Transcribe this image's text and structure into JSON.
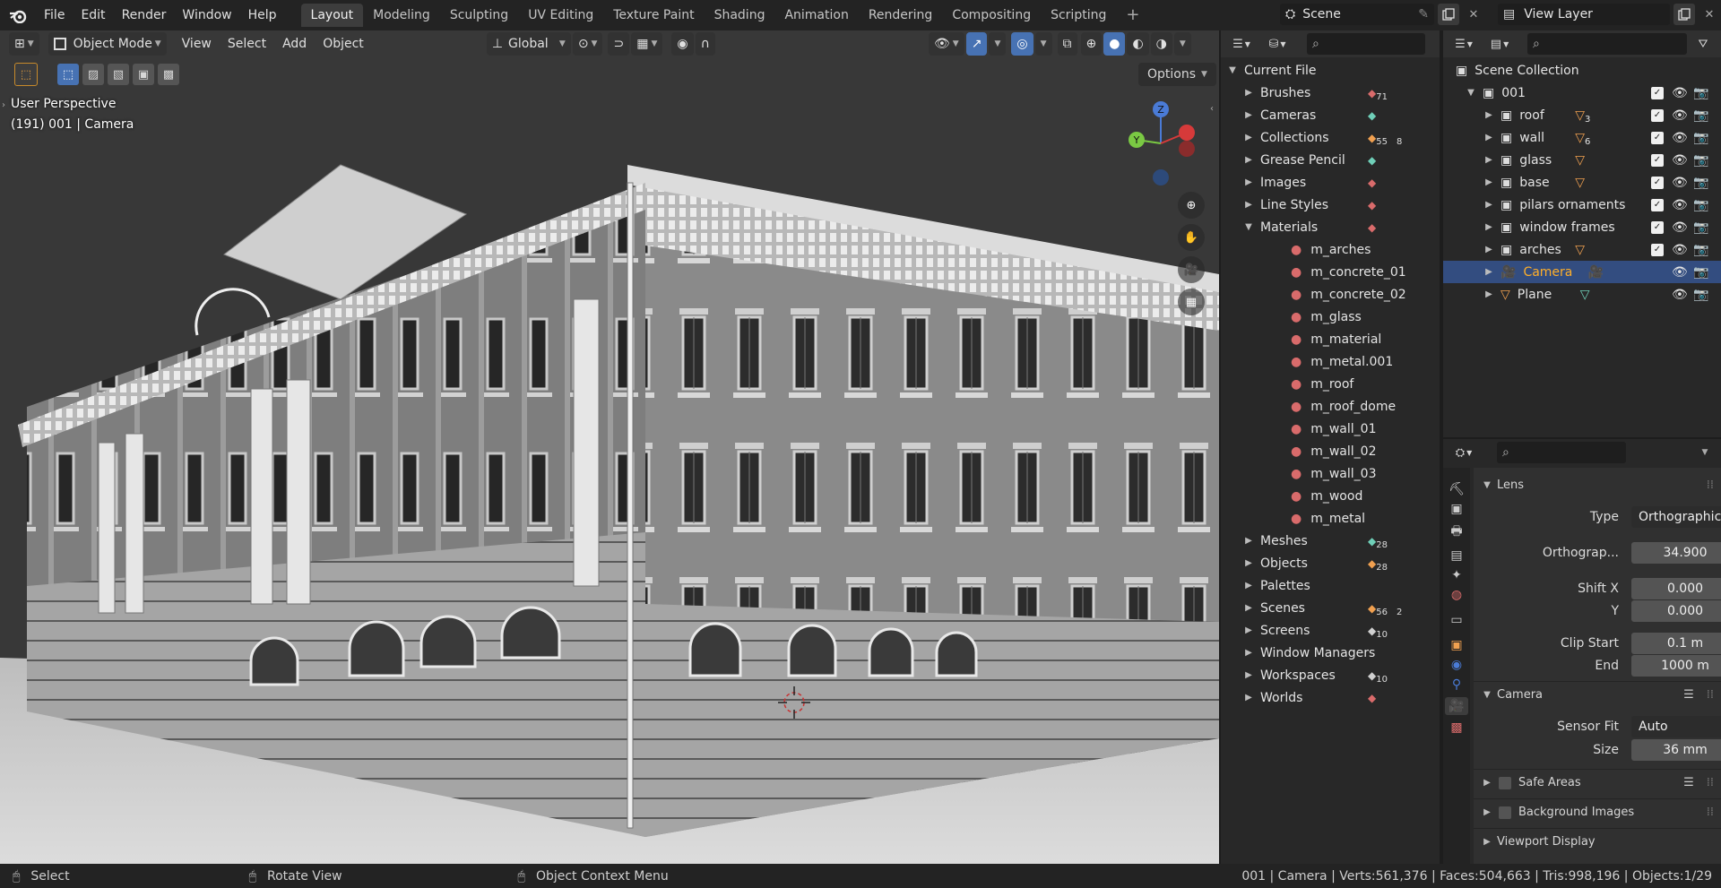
{
  "topbar": {
    "menus": [
      "File",
      "Edit",
      "Render",
      "Window",
      "Help"
    ],
    "workspaces": [
      "Layout",
      "Modeling",
      "Sculpting",
      "UV Editing",
      "Texture Paint",
      "Shading",
      "Animation",
      "Rendering",
      "Compositing",
      "Scripting"
    ],
    "active_workspace": "Layout",
    "add_workspace": "+",
    "scene": "Scene",
    "view_layer": "View Layer"
  },
  "viewport": {
    "mode": "Object Mode",
    "menus": [
      "View",
      "Select",
      "Add",
      "Object"
    ],
    "orientation": "Global",
    "options": "Options",
    "overlay_title": "User Perspective",
    "overlay_sub": "(191) 001 | Camera",
    "gizmo": {
      "z": "Z",
      "y": "Y"
    }
  },
  "file_browser": {
    "root": "Current File",
    "items": [
      {
        "label": "Brushes",
        "count": "71",
        "color": "#d96b6b"
      },
      {
        "label": "Cameras",
        "count": "",
        "color": "#6fcfb8"
      },
      {
        "label": "Collections",
        "count": "55",
        "count2": "8",
        "color": "#f0a050"
      },
      {
        "label": "Grease Pencil",
        "count": "",
        "color": "#6fcfb8"
      },
      {
        "label": "Images",
        "count": "",
        "color": "#d96b6b"
      },
      {
        "label": "Line Styles",
        "count": "",
        "color": "#d96b6b"
      },
      {
        "label": "Materials",
        "count": "",
        "color": "#d96b6b",
        "expanded": true
      },
      {
        "label": "Meshes",
        "count": "28",
        "color": "#6fcfb8"
      },
      {
        "label": "Objects",
        "count": "28",
        "color": "#f0a050"
      },
      {
        "label": "Palettes",
        "count": "",
        "color": ""
      },
      {
        "label": "Scenes",
        "count": "56",
        "count2": "2",
        "color": "#f0a050"
      },
      {
        "label": "Screens",
        "count": "10",
        "color": "#d0d0d0"
      },
      {
        "label": "Window Managers",
        "count": "",
        "color": ""
      },
      {
        "label": "Workspaces",
        "count": "10",
        "color": "#d0d0d0"
      },
      {
        "label": "Worlds",
        "count": "",
        "color": "#d96b6b"
      }
    ],
    "materials": [
      "m_arches",
      "m_concrete_01",
      "m_concrete_02",
      "m_glass",
      "m_material",
      "m_metal.001",
      "m_roof",
      "m_roof_dome",
      "m_wall_01",
      "m_wall_02",
      "m_wall_03",
      "m_wood",
      "m_metal"
    ]
  },
  "outliner": {
    "root": "Scene Collection",
    "collection": "001",
    "items": [
      {
        "label": "roof",
        "count": "3",
        "selected": false,
        "type": "collection"
      },
      {
        "label": "wall",
        "count": "6",
        "selected": false,
        "type": "collection"
      },
      {
        "label": "glass",
        "count": "",
        "selected": false,
        "type": "collection"
      },
      {
        "label": "base",
        "count": "",
        "selected": false,
        "type": "collection"
      },
      {
        "label": "pilars ornaments",
        "count": "",
        "selected": false,
        "type": "collection"
      },
      {
        "label": "window frames",
        "count": "",
        "selected": false,
        "type": "collection"
      },
      {
        "label": "arches",
        "count": "",
        "selected": false,
        "type": "collection"
      },
      {
        "label": "Camera",
        "count": "",
        "selected": true,
        "type": "camera"
      },
      {
        "label": "Plane",
        "count": "",
        "selected": false,
        "type": "object"
      }
    ]
  },
  "properties": {
    "lens_title": "Lens",
    "type_label": "Type",
    "type_value": "Orthographic",
    "ortho_label": "Orthograp...",
    "ortho_value": "34.900",
    "shiftx_label": "Shift X",
    "shiftx_value": "0.000",
    "shifty_label": "Y",
    "shifty_value": "0.000",
    "clipstart_label": "Clip Start",
    "clipstart_value": "0.1 m",
    "clipend_label": "End",
    "clipend_value": "1000 m",
    "camera_title": "Camera",
    "sensorfit_label": "Sensor Fit",
    "sensorfit_value": "Auto",
    "size_label": "Size",
    "size_value": "36 mm",
    "safe_areas": "Safe Areas",
    "background_images": "Background Images",
    "viewport_display": "Viewport Display"
  },
  "statusbar": {
    "select": "Select",
    "rotate": "Rotate View",
    "context": "Object Context Menu",
    "stats": "001 | Camera | Verts:561,376 | Faces:504,663 | Tris:998,196 | Objects:1/29"
  }
}
